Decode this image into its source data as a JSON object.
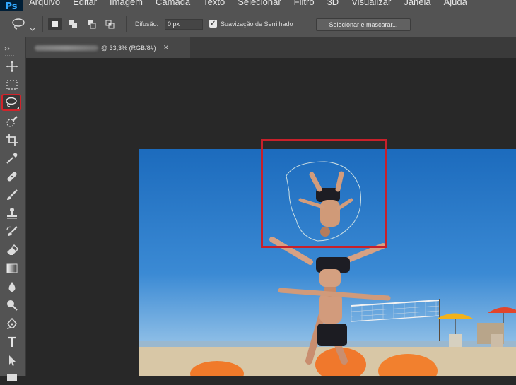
{
  "app": {
    "logo": "Ps"
  },
  "menu": {
    "items": [
      "Arquivo",
      "Editar",
      "Imagem",
      "Camada",
      "Texto",
      "Selecionar",
      "Filtro",
      "3D",
      "Visualizar",
      "Janela",
      "Ajuda"
    ]
  },
  "options_bar": {
    "tool_icon": "lasso-icon",
    "selection_modes": [
      "new-selection",
      "add-to-selection",
      "subtract-from-selection",
      "intersect-with-selection"
    ],
    "feather_label": "Difusão:",
    "feather_value": "0 px",
    "antialias_label": "Suavização de Serrilhado",
    "antialias_checked": true,
    "select_mask_label": "Selecionar e mascarar..."
  },
  "document_tab": {
    "title_suffix": "@ 33,3% (RGB/8#)",
    "close_glyph": "×"
  },
  "toolbar": {
    "tools": [
      "move",
      "rectangular-marquee",
      "lasso",
      "quick-selection",
      "crop",
      "eyedropper",
      "spot-healing",
      "brush",
      "clone-stamp",
      "history-brush",
      "eraser",
      "gradient",
      "blur",
      "dodge",
      "pen",
      "type",
      "path-selection",
      "rectangle"
    ],
    "selected_tool": "lasso"
  },
  "colors": {
    "highlight": "#c8202a",
    "panel": "#535353",
    "canvas_bg": "#282828"
  }
}
